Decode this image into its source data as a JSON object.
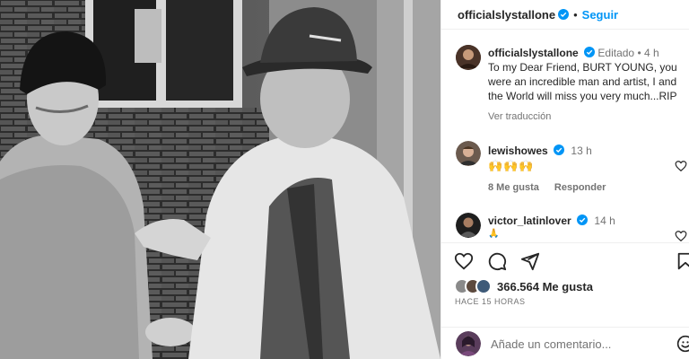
{
  "post": {
    "author": "officialslystallone",
    "follow_label": "Seguir",
    "separator": "•"
  },
  "caption": {
    "author": "officialslystallone",
    "edited": "Editado",
    "separator": "•",
    "time": "4 h",
    "text": "To my Dear Friend, BURT YOUNG, you were an incredible man and artist, I and the World will miss you very much...RIP",
    "translate": "Ver traducción"
  },
  "comments": [
    {
      "author": "lewishowes",
      "time": "13 h",
      "text": "🙌🙌🙌",
      "likes": "8 Me gusta",
      "reply": "Responder"
    },
    {
      "author": "victor_latinlover",
      "time": "14 h",
      "text": "🙏"
    }
  ],
  "likes": {
    "count_text": "366.564 Me gusta"
  },
  "posted": "HACE 15 HORAS",
  "add_comment": {
    "placeholder": "Añade un comentario..."
  },
  "icons": {
    "verified": "verified-badge-icon",
    "like": "heart-icon",
    "comment": "comment-icon",
    "share": "share-icon",
    "save": "bookmark-icon",
    "emoji": "smiley-icon"
  },
  "colors": {
    "link_blue": "#0095f6",
    "verified_blue": "#0095f6",
    "text": "#262626",
    "muted": "#737373",
    "divider": "#efefef"
  }
}
